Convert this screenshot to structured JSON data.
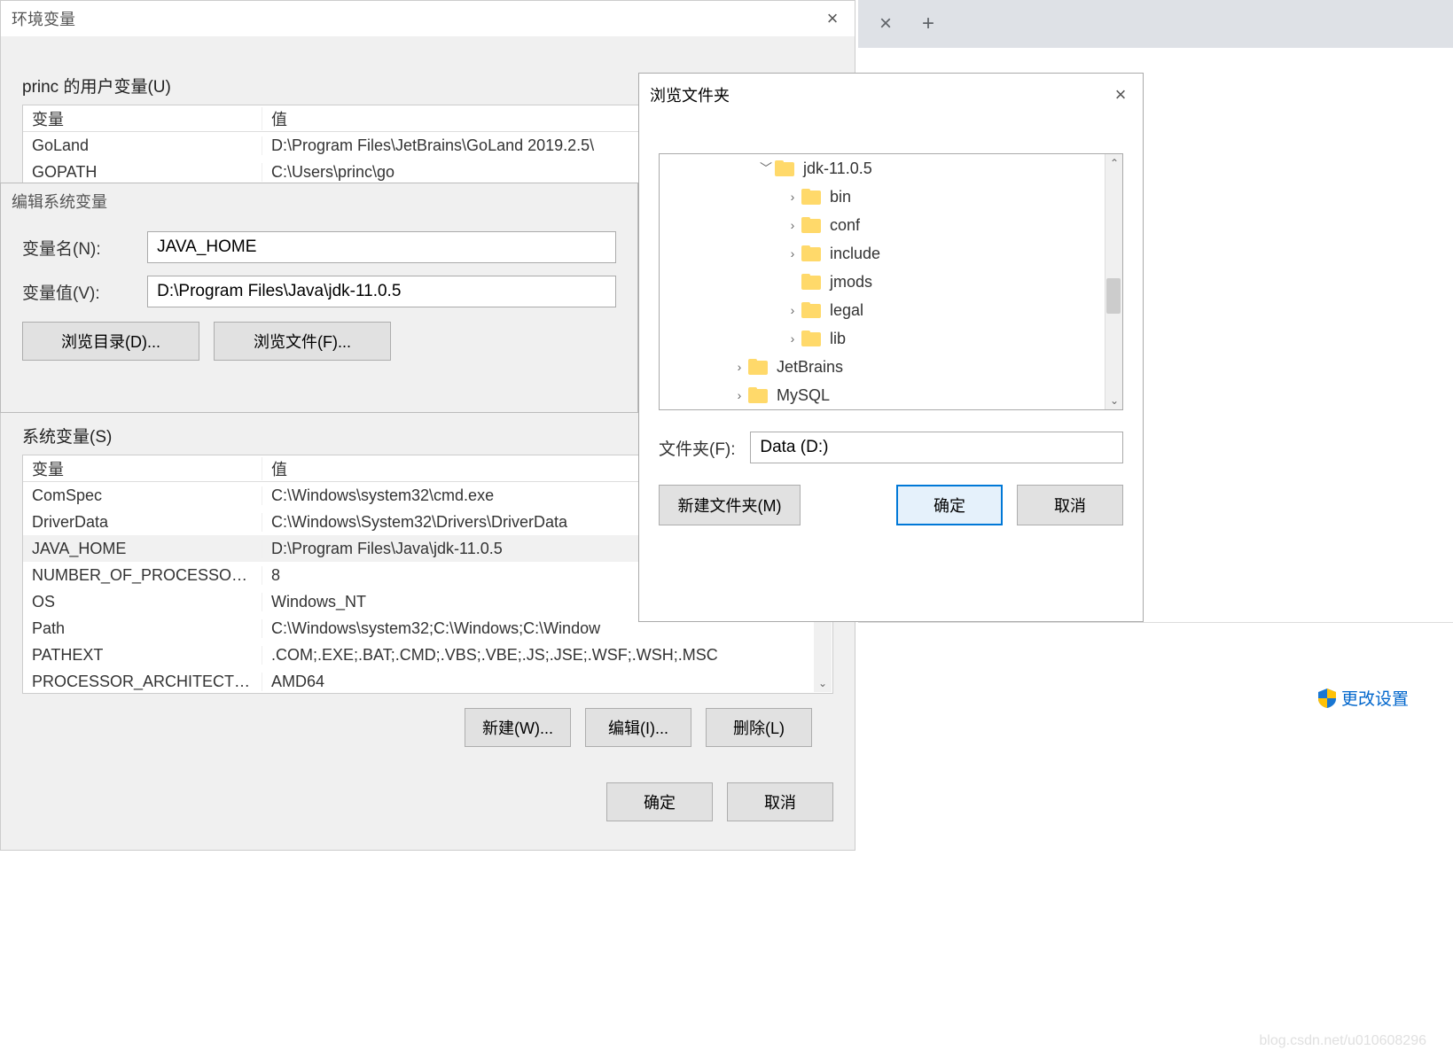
{
  "browser_tabs": {
    "close": "×",
    "plus": "+"
  },
  "env": {
    "title": "环境变量",
    "close": "×",
    "user_label": "princ 的用户变量(U)",
    "user_cols": {
      "name": "变量",
      "value": "值"
    },
    "user_rows": [
      {
        "name": "GoLand",
        "value": "D:\\Program Files\\JetBrains\\GoLand 2019.2.5\\"
      },
      {
        "name": "GOPATH",
        "value": "C:\\Users\\princ\\go"
      }
    ],
    "sys_label": "系统变量(S)",
    "sys_cols": {
      "name": "变量",
      "value": "值"
    },
    "sys_rows": [
      {
        "name": "ComSpec",
        "value": "C:\\Windows\\system32\\cmd.exe"
      },
      {
        "name": "DriverData",
        "value": "C:\\Windows\\System32\\Drivers\\DriverData"
      },
      {
        "name": "JAVA_HOME",
        "value": "D:\\Program Files\\Java\\jdk-11.0.5",
        "selected": true
      },
      {
        "name": "NUMBER_OF_PROCESSORS",
        "value": "8"
      },
      {
        "name": "OS",
        "value": "Windows_NT"
      },
      {
        "name": "Path",
        "value": "C:\\Windows\\system32;C:\\Windows;C:\\Window"
      },
      {
        "name": "PATHEXT",
        "value": ".COM;.EXE;.BAT;.CMD;.VBS;.VBE;.JS;.JSE;.WSF;.WSH;.MSC"
      },
      {
        "name": "PROCESSOR_ARCHITECTU...",
        "value": "AMD64"
      }
    ],
    "btns": {
      "new": "新建(W)...",
      "edit": "编辑(I)...",
      "del": "删除(L)",
      "ok": "确定",
      "cancel": "取消"
    }
  },
  "edit": {
    "title": "编辑系统变量",
    "name_label": "变量名(N):",
    "name_value": "JAVA_HOME",
    "val_label": "变量值(V):",
    "val_value": "D:\\Program Files\\Java\\jdk-11.0.5",
    "browse_dir": "浏览目录(D)...",
    "browse_file": "浏览文件(F)..."
  },
  "browse": {
    "title": "浏览文件夹",
    "close": "×",
    "tree": [
      {
        "indent": 110,
        "expand": "﹀",
        "label": "jdk-11.0.5"
      },
      {
        "indent": 140,
        "expand": "›",
        "label": "bin"
      },
      {
        "indent": 140,
        "expand": "›",
        "label": "conf"
      },
      {
        "indent": 140,
        "expand": "›",
        "label": "include"
      },
      {
        "indent": 140,
        "expand": "",
        "label": "jmods"
      },
      {
        "indent": 140,
        "expand": "›",
        "label": "legal"
      },
      {
        "indent": 140,
        "expand": "›",
        "label": "lib"
      },
      {
        "indent": 80,
        "expand": "›",
        "label": "JetBrains"
      },
      {
        "indent": 80,
        "expand": "›",
        "label": "MySQL"
      }
    ],
    "folder_label": "文件夹(F):",
    "folder_value": "Data (D:)",
    "new_folder": "新建文件夹(M)",
    "ok": "确定",
    "cancel": "取消"
  },
  "link": {
    "text": "更改设置"
  },
  "watermark": "blog.csdn.net/u010608296"
}
